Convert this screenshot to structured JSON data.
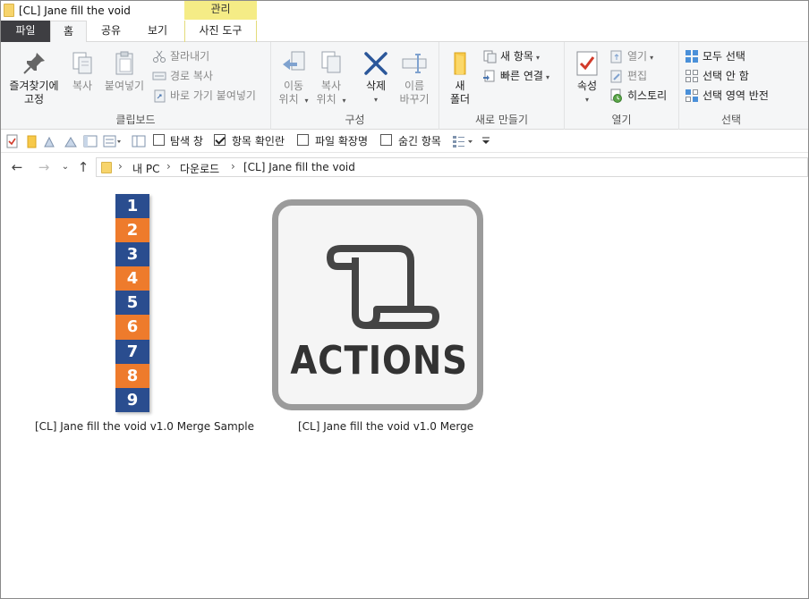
{
  "window": {
    "title": "[CL] Jane fill the void",
    "contextual_tab_group": "관리"
  },
  "tabs": {
    "file": "파일",
    "home": "홈",
    "share": "공유",
    "view": "보기",
    "photo_tools": "사진 도구"
  },
  "ribbon": {
    "clipboard": {
      "label": "클립보드",
      "pin": "즐겨찾기에\n고정",
      "copy": "복사",
      "paste": "붙여넣기",
      "cut": "잘라내기",
      "copy_path": "경로 복사",
      "paste_shortcut": "바로 가기 붙여넣기"
    },
    "organize": {
      "label": "구성",
      "move_to": "이동\n위치",
      "copy_to": "복사\n위치",
      "delete": "삭제",
      "rename": "이름\n바꾸기"
    },
    "new": {
      "label": "새로 만들기",
      "new_folder": "새\n폴더",
      "new_item": "새 항목",
      "easy_access": "빠른 연결"
    },
    "open": {
      "label": "열기",
      "properties": "속성",
      "open": "열기",
      "edit": "편집",
      "history": "히스토리"
    },
    "select": {
      "label": "선택",
      "select_all": "모두 선택",
      "select_none": "선택 안 함",
      "invert": "선택 영역 반전"
    }
  },
  "quickbar": {
    "nav_pane": "탐색 창",
    "item_checkboxes": "항목 확인란",
    "file_extensions": "파일 확장명",
    "hidden_items": "숨긴 항목",
    "item_checkboxes_checked": true,
    "nav_pane_checked": false,
    "file_extensions_checked": false,
    "hidden_items_checked": false
  },
  "address": {
    "crumbs": [
      "내 PC",
      "다운로드",
      "[CL] Jane fill the void"
    ]
  },
  "files": [
    {
      "name": "[CL] Jane fill the void v1.0 Merge Sample",
      "thumbnail": "numbered-strip",
      "strip": [
        "1",
        "2",
        "3",
        "4",
        "5",
        "6",
        "7",
        "8",
        "9"
      ],
      "strip_colors": [
        "#2a4d8f",
        "#ee7b2c"
      ]
    },
    {
      "name": "[CL] Jane fill the void v1.0 Merge",
      "thumbnail": "actions-scroll-icon",
      "icon_text": "ACTIONS"
    }
  ],
  "colors": {
    "file_tab": "#3e3e42",
    "contextual_tab": "#f5ec86",
    "ribbon_bg": "#f5f6f7",
    "delete_x": "#2b579a",
    "properties_check": "#d23a2a"
  }
}
